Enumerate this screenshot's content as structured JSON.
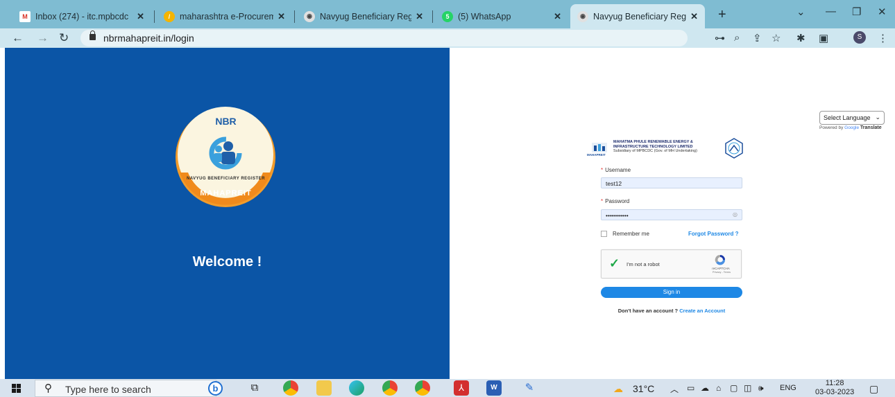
{
  "browser": {
    "tabs": [
      {
        "title": "Inbox (274) - itc.mpbcdc",
        "icon": "gmail-icon",
        "active": false
      },
      {
        "title": "maharashtra e-Procureme",
        "icon": "eprocurement-icon",
        "active": false
      },
      {
        "title": "Navyug Beneficiary Regis",
        "icon": "nbr-site-icon",
        "active": false
      },
      {
        "title": "(5) WhatsApp",
        "icon": "whatsapp-icon",
        "active": false
      },
      {
        "title": "Navyug Beneficiary Regis",
        "icon": "nbr-site-icon",
        "active": true
      }
    ],
    "url": "nbrmahapreit.in/login",
    "profile_initial": "S"
  },
  "welcome_panel": {
    "logo_top": "NBR",
    "logo_arc": "NAVYUG BENEFICIARY REGISTER",
    "logo_bottom": "MAHAPREIT",
    "welcome_text": "Welcome !",
    "bg_color": "#0b55a6"
  },
  "language": {
    "select_label": "Select Language",
    "powered_by": "Powered by",
    "google": "Google",
    "translate": "Translate"
  },
  "org": {
    "line1": "MAHATMA PHULE RENEWABLE ENERGY &",
    "line2": "INFRASTRUCTURE TECHNOLOGY LIMITED",
    "line3": "Subsidiary of MPBCDC (Gov. of MH Undertaking)",
    "small_logo_text": "MAHAPREIT"
  },
  "form": {
    "username_label": "Username",
    "username_value": "test12",
    "password_label": "Password",
    "password_value": "•••••••••••",
    "remember_label": "Remember me",
    "forgot_label": "Forgot Password ?",
    "captcha_text": "I'm not a robot",
    "captcha_brand": "reCAPTCHA",
    "captcha_links": "Privacy - Terms",
    "signin_label": "Sign in",
    "no_account_text": "Don't have an account ?",
    "create_account_label": "Create an Account",
    "accent_color": "#1e88e5"
  },
  "taskbar": {
    "search_placeholder": "Type here to search",
    "weather": "31°C",
    "language": "ENG",
    "time": "11:28",
    "date": "03-03-2023"
  }
}
